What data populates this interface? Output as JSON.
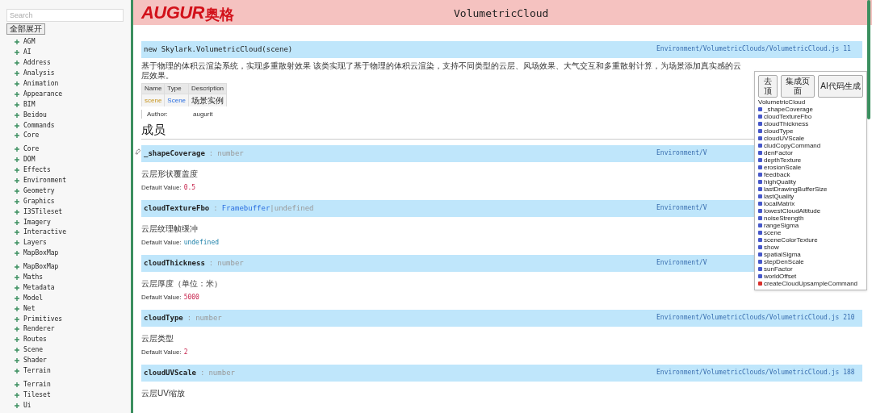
{
  "sidebar": {
    "search": {
      "placeholder": "Search"
    },
    "expand_button": "全部展开",
    "groups": [
      [
        "AGM",
        "AI",
        "Address",
        "Analysis",
        "Animation",
        "Appearance",
        "BIM",
        "Beidou",
        "Commands",
        "Core"
      ],
      [
        "Core",
        "DOM",
        "Effects",
        "Environment",
        "Geometry",
        "Graphics",
        "I3STileset",
        "Imagery",
        "Interactive",
        "Layers",
        "MapBoxMap"
      ],
      [
        "MapBoxMap",
        "Maths",
        "Metadata",
        "Model",
        "Net",
        "Primitives",
        "Renderer",
        "Routes",
        "Scene",
        "Shader",
        "Terrain"
      ],
      [
        "Terrain",
        "Tileset",
        "Ui"
      ]
    ]
  },
  "header": {
    "logo": "AUGUR",
    "logo_cn": "奥格",
    "title": "VolumetricCloud"
  },
  "constructor": {
    "signature": "new Skylark.VolumetricCloud(scene)",
    "source": "Environment/VolumetricClouds/VolumetricCloud.js 11",
    "description": "基于物理的体积云渲染系统，实现多重散射效果 该类实现了基于物理的体积云渲染，支持不同类型的云层、风场效果、大气交互和多重散射计算，为场景添加真实感的云层效果。",
    "params": {
      "columns": [
        "Name",
        "Type",
        "Description"
      ],
      "rows": [
        [
          "scene",
          "Scene",
          "场景实例"
        ]
      ]
    },
    "author_label": "Author:",
    "author": "augurit"
  },
  "members_heading": "成员",
  "members": [
    {
      "name": "_shapeCoverage",
      "type": [
        {
          "text": "number",
          "linked": false
        }
      ],
      "source": "Environment/V",
      "linked_anchor": true,
      "separator": ":",
      "description": "云层形状覆盖度",
      "default_label": "Default Value:",
      "default": {
        "kind": "number",
        "text": "0.5"
      }
    },
    {
      "name": "cloudTextureFbo",
      "type": [
        {
          "text": "Framebuffer",
          "linked": true
        },
        {
          "text": "|undefined",
          "linked": false
        }
      ],
      "source": "Environment/V",
      "linked_anchor": false,
      "separator": ":",
      "description": "云层纹理帧缓冲",
      "default_label": "Default Value:",
      "default": {
        "kind": "keyword",
        "text": "undefined"
      }
    },
    {
      "name": "cloudThickness",
      "type": [
        {
          "text": "number",
          "linked": false
        }
      ],
      "source": "Environment/V",
      "linked_anchor": false,
      "separator": ":",
      "description": "云层厚度（单位：米）",
      "default_label": "Default Value:",
      "default": {
        "kind": "number",
        "text": "5000"
      }
    },
    {
      "name": "cloudType",
      "type": [
        {
          "text": "number",
          "linked": false
        }
      ],
      "source": "Environment/VolumetricClouds/VolumetricCloud.js 210",
      "linked_anchor": false,
      "separator": ":",
      "description": "云层类型",
      "default_label": "Default Value:",
      "default": {
        "kind": "number",
        "text": "2"
      }
    },
    {
      "name": "cloudUVScale",
      "type": [
        {
          "text": "number",
          "linked": false
        }
      ],
      "source": "Environment/VolumetricClouds/VolumetricCloud.js 188",
      "linked_anchor": false,
      "separator": ":",
      "description": "云层UV缩放"
    }
  ],
  "toc": {
    "buttons": [
      "去顶",
      "集成页面",
      "AI代码生成"
    ],
    "title": "VolumetricCloud",
    "items": [
      {
        "label": "_shapeCoverage",
        "kind": "member"
      },
      {
        "label": "cloudTextureFbo",
        "kind": "member"
      },
      {
        "label": "cloudThickness",
        "kind": "member"
      },
      {
        "label": "cloudType",
        "kind": "member"
      },
      {
        "label": "cloudUVScale",
        "kind": "member"
      },
      {
        "label": "cludCopyCommand",
        "kind": "member"
      },
      {
        "label": "denFactor",
        "kind": "member"
      },
      {
        "label": "depthTexture",
        "kind": "member"
      },
      {
        "label": "erosionScale",
        "kind": "member"
      },
      {
        "label": "feedback",
        "kind": "member"
      },
      {
        "label": "highQuality",
        "kind": "member"
      },
      {
        "label": "lastDrawingBufferSize",
        "kind": "member"
      },
      {
        "label": "lastQuality",
        "kind": "member"
      },
      {
        "label": "localMatrix",
        "kind": "member"
      },
      {
        "label": "lowestCloudAltitude",
        "kind": "member"
      },
      {
        "label": "noiseStrength",
        "kind": "member"
      },
      {
        "label": "rangeSigma",
        "kind": "member"
      },
      {
        "label": "scene",
        "kind": "member"
      },
      {
        "label": "sceneColorTexture",
        "kind": "member"
      },
      {
        "label": "show",
        "kind": "member"
      },
      {
        "label": "spatialSigma",
        "kind": "member"
      },
      {
        "label": "stepDenScale",
        "kind": "member"
      },
      {
        "label": "sunFactor",
        "kind": "member"
      },
      {
        "label": "worldOffset",
        "kind": "member"
      },
      {
        "label": "createCloudUpsampleCommand",
        "kind": "method"
      }
    ]
  }
}
